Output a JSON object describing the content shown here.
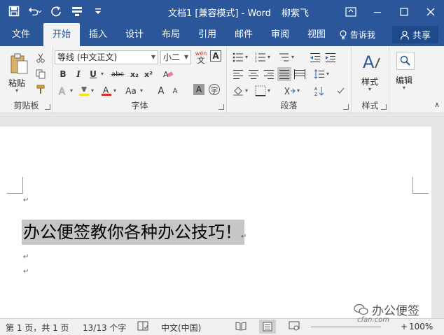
{
  "titlebar": {
    "title": "文档1 [兼容模式] - Word",
    "user": "柳紫飞",
    "bg_color": "#2b579a"
  },
  "qat": {
    "icons": [
      "save-icon",
      "undo-icon",
      "redo-icon",
      "touch-mode-icon",
      "customize-icon"
    ]
  },
  "tabs": {
    "file": "文件",
    "home": "开始",
    "insert": "插入",
    "design": "设计",
    "layout": "布局",
    "references": "引用",
    "mailings": "邮件",
    "review": "审阅",
    "view": "视图",
    "tell_me": "告诉我",
    "share": "共享"
  },
  "ribbon": {
    "clipboard": {
      "label": "剪贴板",
      "paste": "粘贴"
    },
    "font": {
      "label": "字体",
      "font_name": "等线 (中文正文)",
      "font_size": "小二",
      "bold": "B",
      "italic": "I",
      "underline": "U",
      "strike": "abc",
      "subscript": "x₂",
      "superscript": "x²",
      "case": "Aa",
      "grow": "A",
      "shrink": "A",
      "char_border": "A",
      "enclose": "字",
      "phonetic_top": "wén",
      "phonetic_bottom": "文"
    },
    "paragraph": {
      "label": "段落"
    },
    "styles": {
      "label": "样式",
      "button": "样式"
    },
    "editing": {
      "button": "编辑"
    }
  },
  "document": {
    "selected_text": "办公便签教你各种办公技巧！"
  },
  "status": {
    "page": "第 1 页，共 1 页",
    "words": "13/13 个字",
    "language": "中文(中国)",
    "zoom": "100%"
  },
  "watermark": {
    "brand": "办公便签",
    "site": "cfan.com"
  }
}
